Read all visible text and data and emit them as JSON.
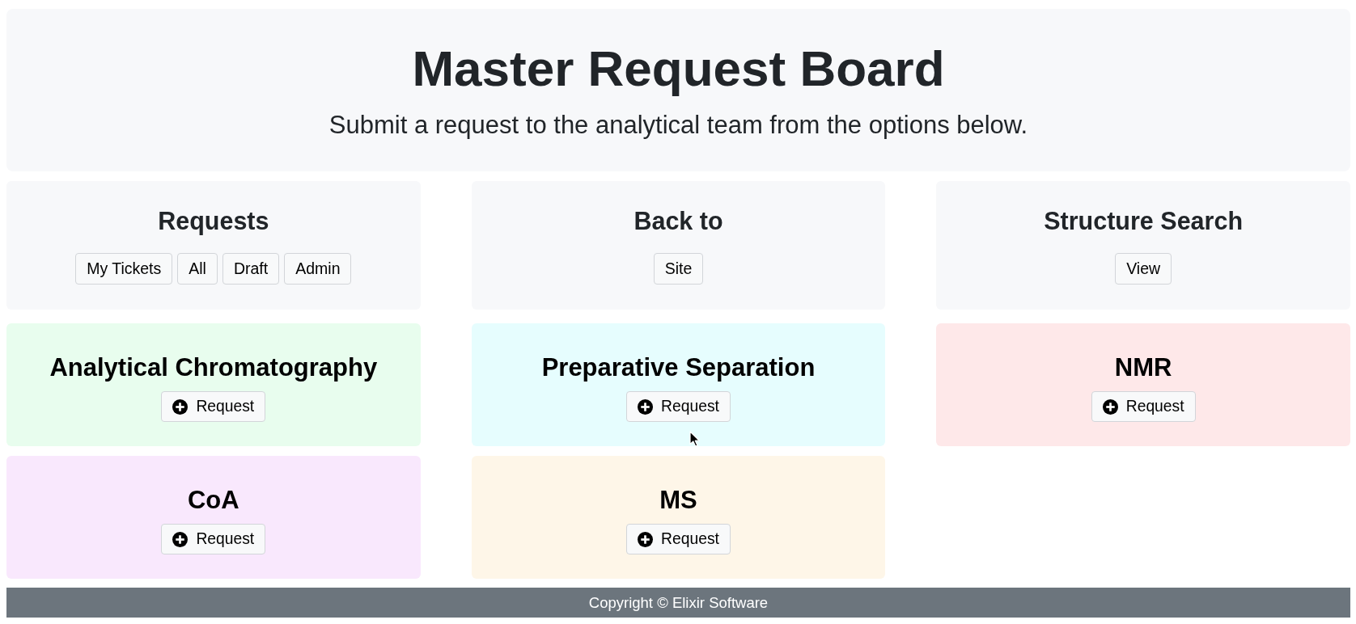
{
  "header": {
    "title": "Master Request Board",
    "subtitle": "Submit a request to the analytical team from the options below."
  },
  "nav_panels": [
    {
      "title": "Requests",
      "buttons": [
        "My Tickets",
        "All",
        "Draft",
        "Admin"
      ]
    },
    {
      "title": "Back to",
      "buttons": [
        "Site"
      ]
    },
    {
      "title": "Structure Search",
      "buttons": [
        "View"
      ]
    }
  ],
  "request_cards": [
    {
      "title": "Analytical Chromatography",
      "button": "Request",
      "color": "#e8fdee"
    },
    {
      "title": "Preparative Separation",
      "button": "Request",
      "color": "#e6fdfe"
    },
    {
      "title": "NMR",
      "button": "Request",
      "color": "#fee8e9"
    },
    {
      "title": "CoA",
      "button": "Request",
      "color": "#f9e8fd"
    },
    {
      "title": "MS",
      "button": "Request",
      "color": "#fef6e8"
    }
  ],
  "footer": {
    "text": "Copyright © Elixir Software"
  }
}
